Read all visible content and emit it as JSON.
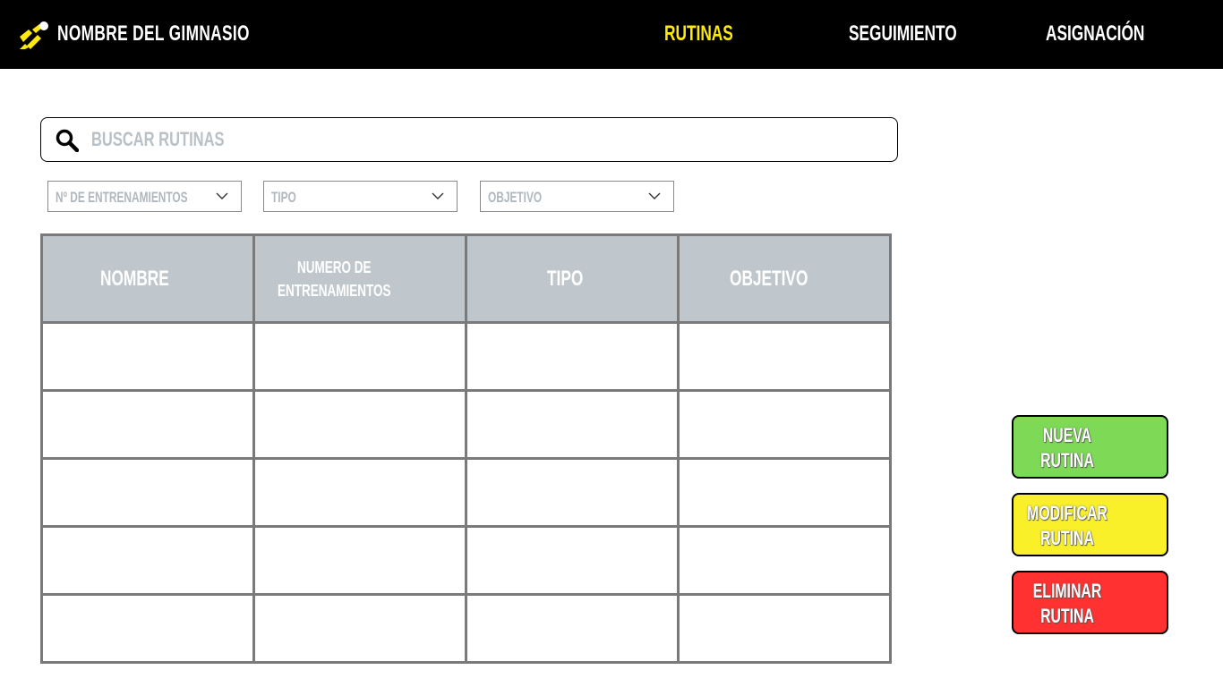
{
  "header": {
    "brand": "NOMBRE DEL GIMNASIO",
    "nav": [
      {
        "label": "RUTINAS",
        "active": true
      },
      {
        "label": "SEGUIMIENTO",
        "active": false
      },
      {
        "label": "ASIGNACIÓN",
        "active": false
      }
    ]
  },
  "search": {
    "placeholder": "BUSCAR RUTINAS",
    "value": ""
  },
  "filters": [
    {
      "label": "Nº DE ENTRENAMIENTOS"
    },
    {
      "label": "TIPO"
    },
    {
      "label": "OBJETIVO"
    }
  ],
  "table": {
    "columns": [
      "NOMBRE",
      "NUMERO DE ENTRENAMIENTOS",
      "TIPO",
      "OBJETIVO"
    ],
    "rows": [
      [
        "",
        "",
        "",
        ""
      ],
      [
        "",
        "",
        "",
        ""
      ],
      [
        "",
        "",
        "",
        ""
      ],
      [
        "",
        "",
        "",
        ""
      ],
      [
        "",
        "",
        "",
        ""
      ]
    ]
  },
  "actions": {
    "new": {
      "line1": "NUEVA",
      "line2": "RUTINA"
    },
    "modify": {
      "line1": "MODIFICAR",
      "line2": "RUTINA"
    },
    "delete": {
      "line1": "ELIMINAR",
      "line2": "RUTINA"
    }
  },
  "colors": {
    "header_bg": "#000000",
    "accent": "#fde910",
    "table_header_bg": "#c0c7cc",
    "new_button": "#7ed957",
    "modify_button": "#f9f02a",
    "delete_button": "#ff3131"
  },
  "icons": {
    "logo": "brand-logo-icon",
    "search": "search-icon",
    "dropdown": "chevron-down-icon"
  }
}
